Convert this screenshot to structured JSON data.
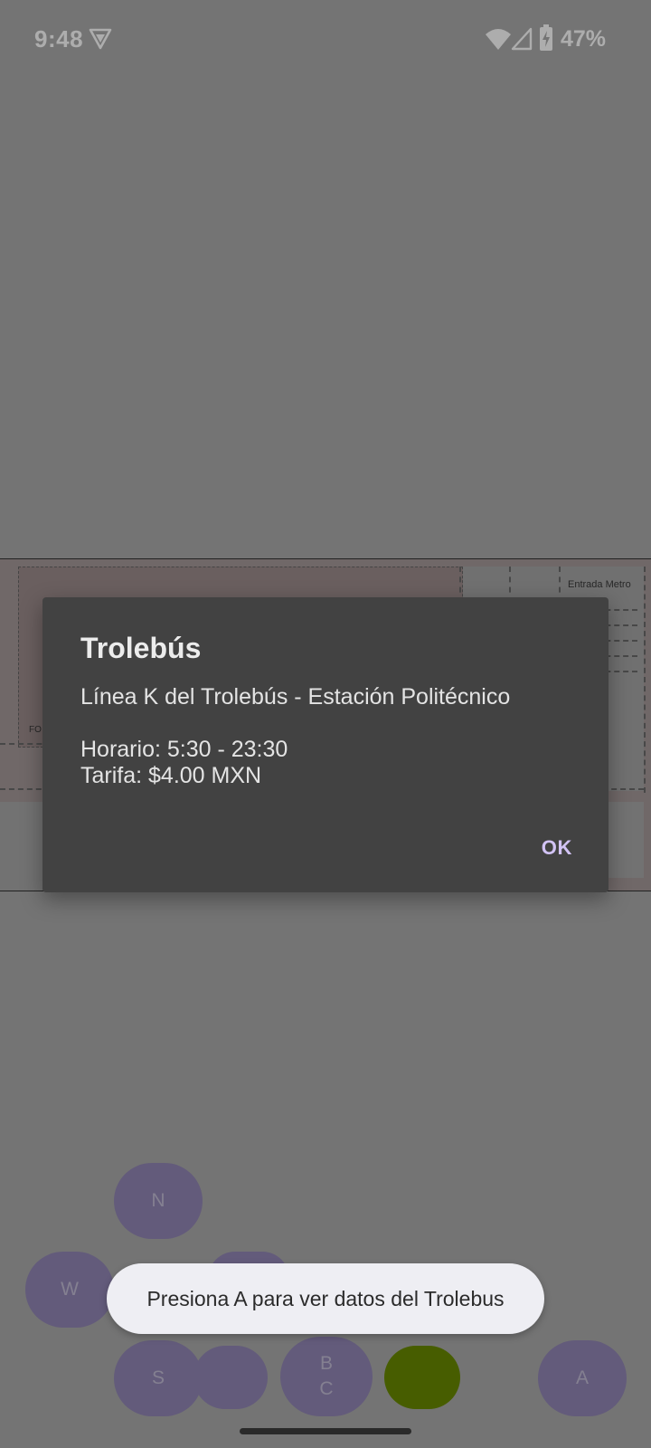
{
  "status_bar": {
    "time": "9:48",
    "battery": "47%"
  },
  "map": {
    "entrance_label": "Entrada Metro",
    "partial_label": "FO"
  },
  "dialog": {
    "title": "Trolebús",
    "message": "Línea K del Trolebús - Estación Politécnico\n\nHorario: 5:30 - 23:30\nTarifa: $4.00 MXN",
    "ok_label": "OK"
  },
  "controls": {
    "north": "N",
    "west": "W",
    "south": "S",
    "bc": "B\nC",
    "a": "A"
  },
  "toast": {
    "text": "Presiona A para ver datos del Trolebus"
  },
  "colors": {
    "dialog_background": "#424242",
    "dialog_accent": "#d2c3f5",
    "control_button": "#9287b5",
    "active_button": "#698a00",
    "toast_background": "#eeeef3"
  }
}
